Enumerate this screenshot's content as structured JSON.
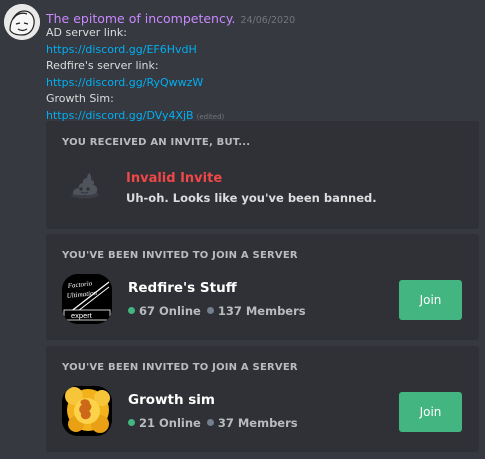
{
  "message": {
    "username": "The epitome of incompetency.",
    "timestamp": "24/06/2020",
    "lines": [
      {
        "type": "text",
        "text": "AD server link:"
      },
      {
        "type": "link",
        "text": "https://discord.gg/EF6HvdH"
      },
      {
        "type": "text",
        "text": "Redfire's server link:"
      },
      {
        "type": "link",
        "text": "https://discord.gg/RyQwwzW"
      },
      {
        "type": "text",
        "text": "Growth Sim:"
      },
      {
        "type": "link",
        "text": "https://discord.gg/DVy4XjB",
        "edited": "(edited)"
      }
    ]
  },
  "invites": {
    "invalid": {
      "heading": "YOU RECEIVED AN INVITE, BUT...",
      "title": "Invalid Invite",
      "subtitle": "Uh-oh. Looks like you've been banned.",
      "icon": "poop-icon"
    },
    "redfire": {
      "heading": "YOU'VE BEEN INVITED TO JOIN A SERVER",
      "name": "Redfire's Stuff",
      "online": "67 Online",
      "members": "137 Members",
      "join_label": "Join",
      "icon_text": [
        "Factorio",
        "Ultimation",
        "expert"
      ]
    },
    "growth": {
      "heading": "YOU'VE BEEN INVITED TO JOIN A SERVER",
      "name": "Growth sim",
      "online": "21 Online",
      "members": "37 Members",
      "join_label": "Join"
    }
  },
  "colors": {
    "background": "#36393f",
    "embed": "#2f3136",
    "username": "#c889ff",
    "link": "#00aff4",
    "danger": "#f04747",
    "join": "#43b581",
    "online": "#43b581",
    "members": "#747f8d"
  }
}
